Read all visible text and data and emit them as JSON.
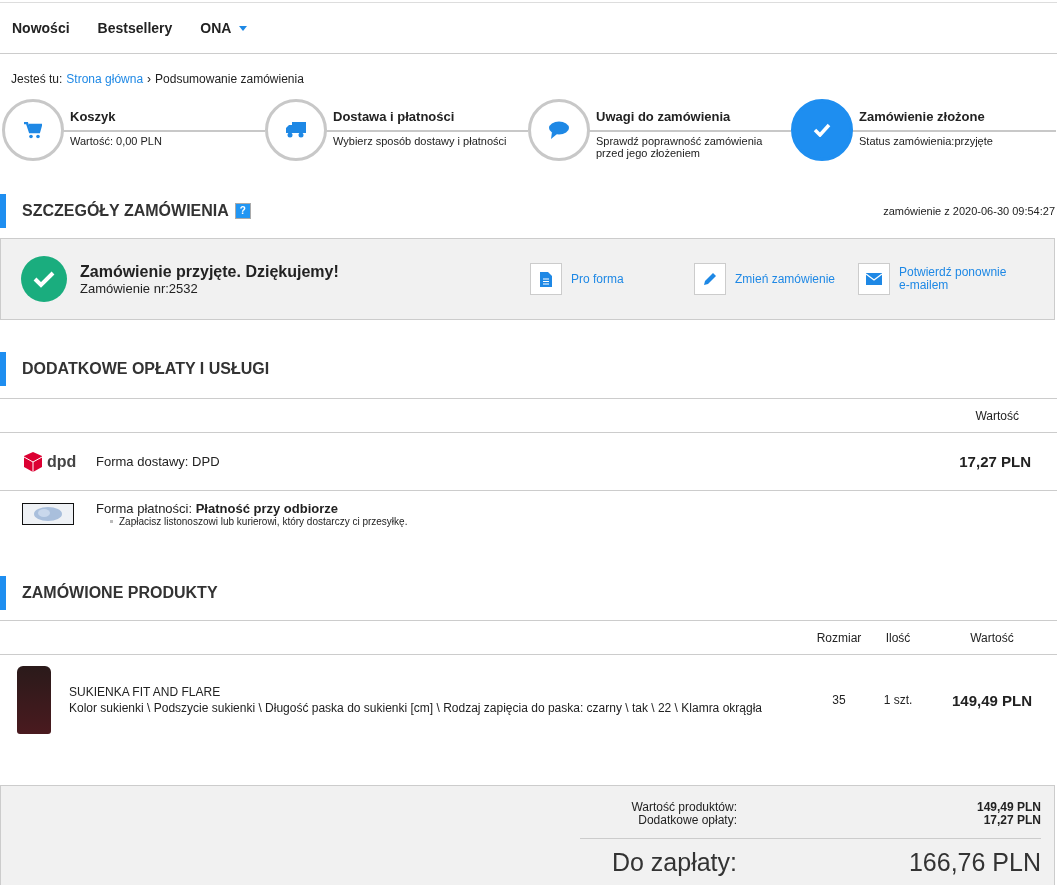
{
  "nav": [
    {
      "label": "Nowości",
      "dropdown": false
    },
    {
      "label": "Bestsellery",
      "dropdown": false
    },
    {
      "label": "ONA",
      "dropdown": true
    }
  ],
  "breadcrumb": {
    "prefix": "Jesteś tu:",
    "link": "Strona główna",
    "separator": "›",
    "current": "Podsumowanie zamówienia"
  },
  "steps": [
    {
      "kind": "cart",
      "title": "Koszyk",
      "description": "Wartość: 0,00 PLN",
      "selected": false
    },
    {
      "kind": "truck",
      "title": "Dostawa i płatności",
      "description": "Wybierz sposób dostawy i płatności",
      "selected": false
    },
    {
      "kind": "comment",
      "title": "Uwagi do zamówienia",
      "description": "Sprawdź poprawność zamówienia przed jego złożeniem",
      "selected": false
    },
    {
      "kind": "check",
      "title": "Zamówienie złożone",
      "description": "Status zamówienia:przyjęte",
      "selected": true
    }
  ],
  "details": {
    "title": "SZCZEGÓŁY ZAMÓWIENIA",
    "help": "?",
    "date": "zamówienie z 2020-06-30 09:54:27",
    "confirmation": "Zamówienie przyjęte. Dziękujemy!",
    "order_number": "Zamówienie nr:2532",
    "actions": [
      {
        "kind": "document",
        "label": "Pro forma"
      },
      {
        "kind": "pencil",
        "label": "Zmień zamówienie"
      },
      {
        "kind": "envelope",
        "label": "Potwierdź ponownie e-mailem"
      }
    ]
  },
  "fees": {
    "title": "DODATKOWE OPŁATY I USŁUGI",
    "columns": [
      "Wartość"
    ],
    "delivery": {
      "logo_text": "dpd",
      "label": "Forma dostawy:",
      "value": "DPD",
      "price": "17,27 PLN"
    },
    "payment": {
      "label": "Forma płatności:",
      "value": "Płatność przy odbiorze",
      "note": "Zapłacisz listonoszowi lub kurierowi, który dostarczy ci przesyłkę."
    }
  },
  "products": {
    "title": "ZAMÓWIONE PRODUKTY",
    "columns": [
      "Rozmiar",
      "Ilość",
      "Wartość"
    ],
    "rows": [
      {
        "name": "SUKIENKA FIT AND FLARE",
        "options": "Kolor sukienki \\ Podszycie sukienki \\ Długość paska do sukienki [cm] \\ Rodzaj zapięcia do paska: czarny \\ tak \\ 22 \\ Klamra okrągła",
        "size": "35",
        "quantity": "1 szt.",
        "price": "149,49 PLN"
      }
    ]
  },
  "summary": {
    "lines": [
      {
        "label": "Wartość produktów:",
        "value": "149,49 PLN"
      },
      {
        "label": "Dodatkowe opłaty:",
        "value": "17,27 PLN"
      }
    ],
    "total_label": "Do zapłaty:",
    "total": "166,76 PLN"
  }
}
